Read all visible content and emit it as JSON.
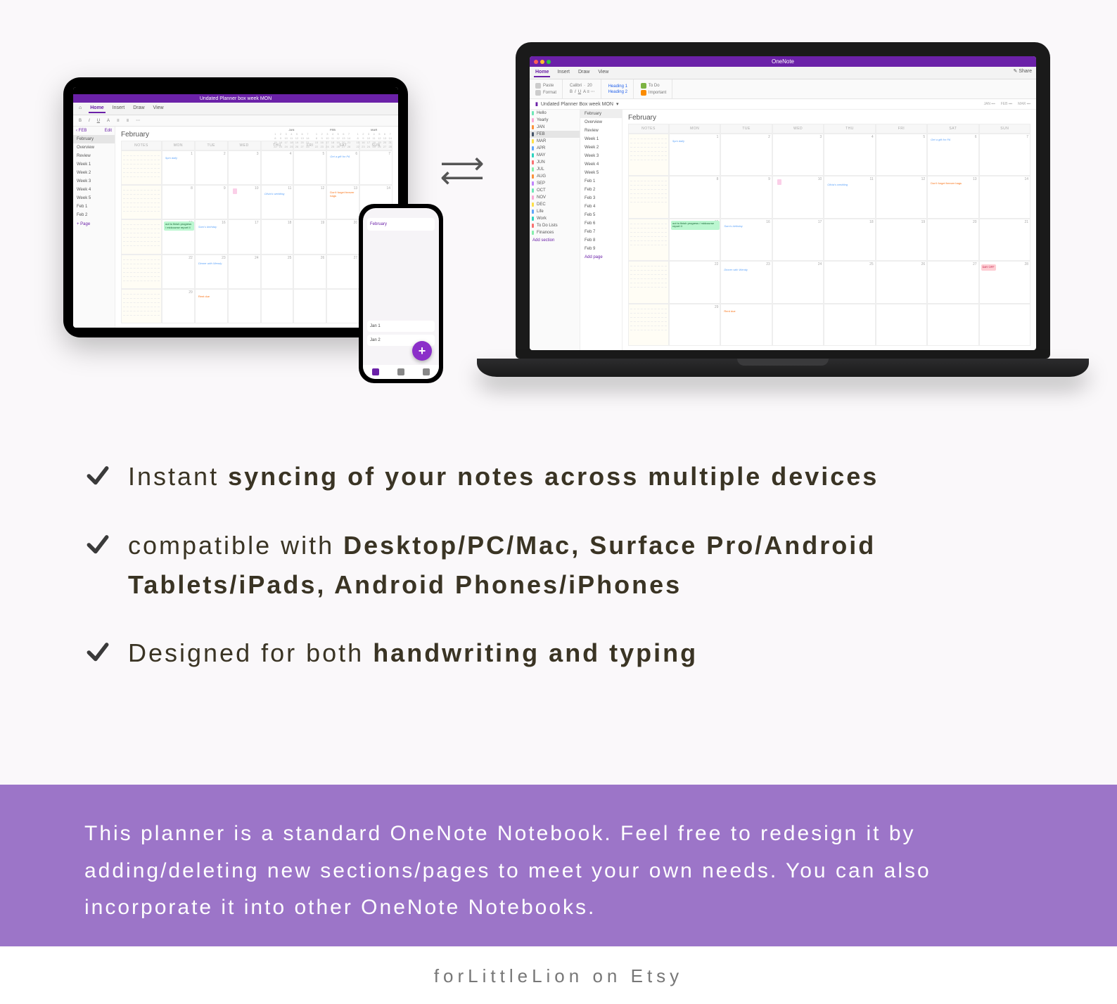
{
  "onenote_app_title": "OneNote",
  "notebook_title_ipad": "Undated Planner box week MON",
  "notebook_title_mac": "Undated Planner Box week MON",
  "menu_tabs": [
    "Home",
    "Insert",
    "Draw",
    "View"
  ],
  "ribbon": {
    "paste": "Paste",
    "format": "Format",
    "font": "Calibri",
    "size": "20",
    "heading1": "Heading 1",
    "heading2": "Heading 2",
    "todo": "To Do",
    "important": "Important",
    "share": "Share"
  },
  "ipad_sidebar": {
    "back_label": "FEB",
    "edit": "Edit",
    "items": [
      "February",
      "Overview",
      "Review",
      "Week 1",
      "Week 2",
      "Week 3",
      "Week 4",
      "Week 5",
      "Feb 1",
      "Feb 2"
    ],
    "add": "Page"
  },
  "mac_sections": [
    {
      "label": "Hello",
      "color": "c-mint"
    },
    {
      "label": "Yearly",
      "color": "c-pink"
    },
    {
      "label": "JAN",
      "color": "c-orange"
    },
    {
      "label": "FEB",
      "color": "c-dark",
      "selected": true
    },
    {
      "label": "MAR",
      "color": "c-yellow"
    },
    {
      "label": "APR",
      "color": "c-blue"
    },
    {
      "label": "MAY",
      "color": "c-teal"
    },
    {
      "label": "JUN",
      "color": "c-red"
    },
    {
      "label": "JUL",
      "color": "c-green"
    },
    {
      "label": "AUG",
      "color": "c-orange"
    },
    {
      "label": "SEP",
      "color": "c-purple"
    },
    {
      "label": "OCT",
      "color": "c-mint"
    },
    {
      "label": "NOV",
      "color": "c-pink"
    },
    {
      "label": "DEC",
      "color": "c-yellow"
    },
    {
      "label": "Life",
      "color": "c-blue"
    },
    {
      "label": "Work",
      "color": "c-teal"
    },
    {
      "label": "To Do Lists",
      "color": "c-red"
    },
    {
      "label": "Finances",
      "color": "c-green"
    }
  ],
  "mac_add_section": "Add section",
  "mac_pages": [
    "February",
    "Overview",
    "Review",
    "Week 1",
    "Week 2",
    "Week 3",
    "Week 4",
    "Week 5",
    "Feb 1",
    "Feb 2",
    "Feb 3",
    "Feb 4",
    "Feb 5",
    "Feb 6",
    "Feb 7",
    "Feb 8",
    "Feb 9"
  ],
  "mac_add_page": "Add page",
  "month_title": "February",
  "mini_months": [
    "JAN",
    "FEB",
    "MAR"
  ],
  "day_headers": [
    "NOTES",
    "MON",
    "TUE",
    "WED",
    "THU",
    "FRI",
    "SAT",
    "SUN"
  ],
  "weeks": [
    [
      "1",
      "2",
      "3",
      "4",
      "5",
      "6",
      "7"
    ],
    [
      "8",
      "9",
      "10",
      "11",
      "12",
      "13",
      "14"
    ],
    [
      "15",
      "16",
      "17",
      "18",
      "19",
      "20",
      "21"
    ],
    [
      "22",
      "23",
      "24",
      "25",
      "26",
      "27",
      "28"
    ],
    [
      "29",
      "",
      "",
      "",
      "",
      "",
      ""
    ]
  ],
  "cal_notes": {
    "gym_daily": "5pm daily",
    "olivia_wedding": "Olivia's wedding",
    "dont_forget": "Don't forget freezer bags",
    "get_gift": "Get a gift for PA",
    "sam_bday": "Sam's birthday",
    "progress_report": "out to finish progress / midcourse report II",
    "dinner_wendy": "Dinner with Wendy",
    "rent_due": "Rent due",
    "day_off": "DAY OFF"
  },
  "features": [
    {
      "pre": "Instant ",
      "bold": "syncing of your notes across multiple devices",
      "post": ""
    },
    {
      "pre": "compatible with ",
      "bold": "Desktop/PC/Mac, Surface Pro/Android Tablets/iPads, Android Phones/iPhones",
      "post": ""
    },
    {
      "pre": "Designed for both ",
      "bold": "handwriting and typing",
      "post": ""
    }
  ],
  "banner_text": "This planner is a standard OneNote Notebook. Feel free to redesign it by adding/deleting new sections/pages to meet your own needs. You can also incorporate it into other OneNote Notebooks.",
  "footer_text": "forLittleLion on Etsy",
  "iphone": {
    "tab": "February",
    "row1": "Jan 1",
    "row2": "Jan 2"
  }
}
